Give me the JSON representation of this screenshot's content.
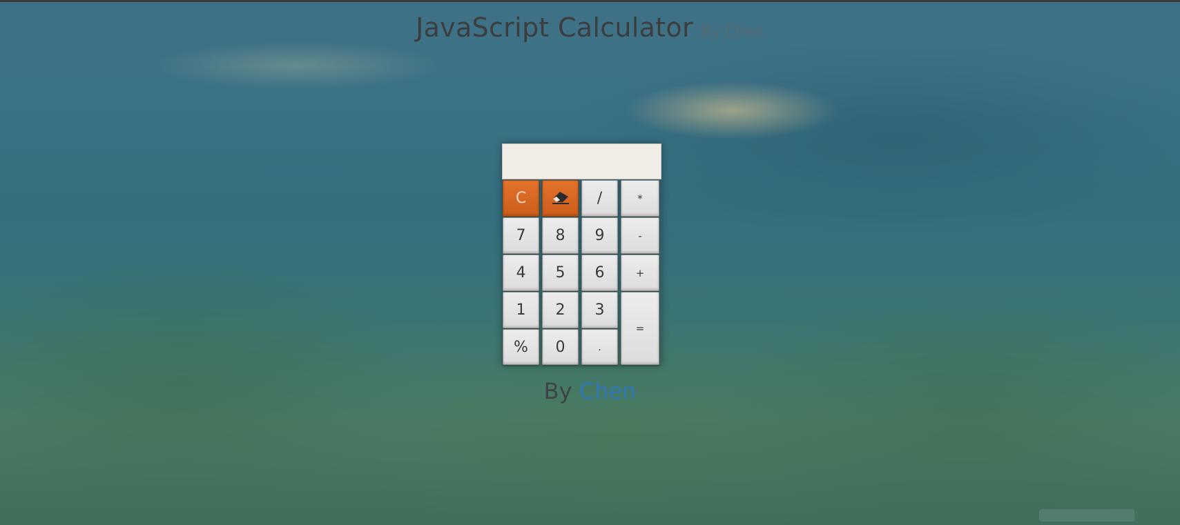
{
  "header": {
    "title": "JavaScript Calculator",
    "byline": "By Chen"
  },
  "calculator": {
    "display_value": "",
    "keys": {
      "clear": "C",
      "divide": "/",
      "multiply": "*",
      "seven": "7",
      "eight": "8",
      "nine": "9",
      "minus": "-",
      "four": "4",
      "five": "5",
      "six": "6",
      "plus": "+",
      "one": "1",
      "two": "2",
      "three": "3",
      "equals": "=",
      "percent": "%",
      "zero": "0",
      "decimal": "."
    },
    "icons": {
      "backspace": "eraser-icon"
    },
    "colors": {
      "accent": "#e2712a",
      "key": "#e4e4e4",
      "display": "#efede6"
    }
  },
  "footer": {
    "by_text": "By",
    "author_link": "Chen"
  }
}
